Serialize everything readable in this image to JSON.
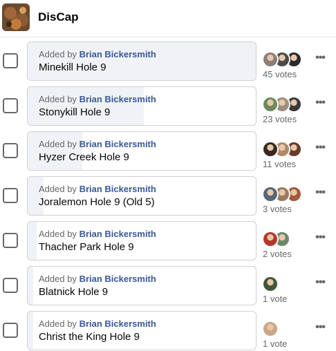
{
  "app": {
    "title": "DisCap"
  },
  "added_by_prefix": "Added by",
  "options": [
    {
      "author": "Brian Bickersmith",
      "name": "Minekill Hole 9",
      "votes": "45 votes",
      "share": 1.0,
      "voter_colors": [
        "#8a7f78",
        "#4a4a4a",
        "#2b2b2b"
      ]
    },
    {
      "author": "Brian Bickersmith",
      "name": "Stonykill Hole 9",
      "votes": "23 votes",
      "share": 0.51,
      "voter_colors": [
        "#6e8a5a",
        "#9a8f80",
        "#3a3a3a"
      ]
    },
    {
      "author": "Brian Bickersmith",
      "name": "Hyzer Creek Hole 9",
      "votes": "11 votes",
      "share": 0.24,
      "voter_colors": [
        "#3b2a22",
        "#b08a6a",
        "#6a3a2a"
      ]
    },
    {
      "author": "Brian Bickersmith",
      "name": "Joralemon Hole 9 (Old 5)",
      "votes": "3 votes",
      "share": 0.07,
      "voter_colors": [
        "#556677",
        "#9a7a60",
        "#a35a3a"
      ]
    },
    {
      "author": "Brian Bickersmith",
      "name": "Thacher Park Hole 9",
      "votes": "2 votes",
      "share": 0.04,
      "voter_colors": [
        "#b03a2e",
        "#6a8a6a"
      ]
    },
    {
      "author": "Brian Bickersmith",
      "name": "Blatnick Hole 9",
      "votes": "1 vote",
      "share": 0.02,
      "voter_colors": [
        "#3e5a3a"
      ]
    },
    {
      "author": "Brian Bickersmith",
      "name": "Christ the King Hole 9",
      "votes": "1 vote",
      "share": 0.02,
      "voter_colors": [
        "#c8a888"
      ]
    }
  ]
}
